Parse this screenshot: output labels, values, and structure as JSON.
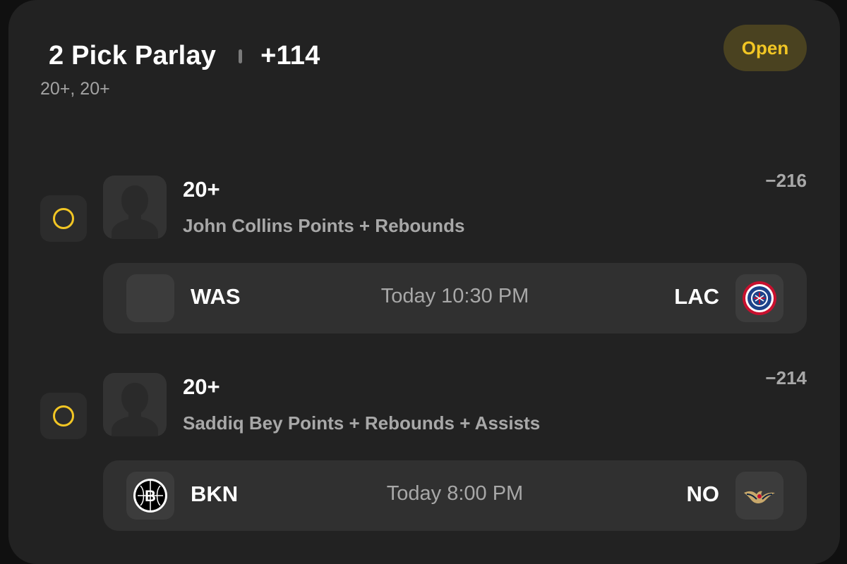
{
  "header": {
    "title": "2 Pick Parlay",
    "odds": "+114",
    "subtitle": "20+, 20+",
    "status": "Open"
  },
  "picks": [
    {
      "line": "20+",
      "description": "John Collins Points + Rebounds",
      "odds": "−216",
      "game": {
        "away": "WAS",
        "home": "LAC",
        "time": "Today 10:30 PM",
        "away_logo": "blank-team-logo",
        "home_logo": "clippers-logo"
      }
    },
    {
      "line": "20+",
      "description": "Saddiq Bey Points + Rebounds + Assists",
      "odds": "−214",
      "game": {
        "away": "BKN",
        "home": "NO",
        "time": "Today 8:00 PM",
        "away_logo": "nets-logo",
        "home_logo": "pelicans-logo"
      }
    }
  ],
  "colors": {
    "accent": "#f2c624",
    "card_bg": "#222222",
    "page_bg": "#101010",
    "muted_text": "#a8a8a8"
  }
}
